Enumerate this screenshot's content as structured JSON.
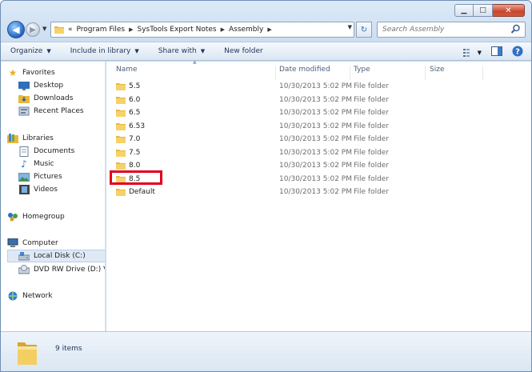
{
  "window": {
    "caption_buttons": {
      "minimize": "▁",
      "maximize": "□",
      "close": "✕"
    }
  },
  "address_bar": {
    "overflow": "«",
    "crumbs": [
      "Program Files",
      "SysTools Export Notes",
      "Assembly"
    ],
    "search_placeholder": "Search Assembly"
  },
  "toolbar": {
    "organize": "Organize",
    "include_in_library": "Include in library",
    "share_with": "Share with",
    "new_folder": "New folder"
  },
  "nav_pane": {
    "favorites": "Favorites",
    "desktop": "Desktop",
    "downloads": "Downloads",
    "recent_places": "Recent Places",
    "libraries": "Libraries",
    "documents": "Documents",
    "music": "Music",
    "pictures": "Pictures",
    "videos": "Videos",
    "homegroup": "Homegroup",
    "computer": "Computer",
    "local_disk": "Local Disk (C:)",
    "dvd_drive": "DVD RW Drive (D:) V",
    "network": "Network"
  },
  "columns": {
    "name": "Name",
    "date_modified": "Date modified",
    "type": "Type",
    "size": "Size"
  },
  "files": [
    {
      "name": "5.5",
      "date": "10/30/2013 5:02 PM",
      "type": "File folder"
    },
    {
      "name": "6.0",
      "date": "10/30/2013 5:02 PM",
      "type": "File folder"
    },
    {
      "name": "6.5",
      "date": "10/30/2013 5:02 PM",
      "type": "File folder"
    },
    {
      "name": "6.53",
      "date": "10/30/2013 5:02 PM",
      "type": "File folder"
    },
    {
      "name": "7.0",
      "date": "10/30/2013 5:02 PM",
      "type": "File folder"
    },
    {
      "name": "7.5",
      "date": "10/30/2013 5:02 PM",
      "type": "File folder"
    },
    {
      "name": "8.0",
      "date": "10/30/2013 5:02 PM",
      "type": "File folder"
    },
    {
      "name": "8.5",
      "date": "10/30/2013 5:02 PM",
      "type": "File folder"
    },
    {
      "name": "Default",
      "date": "10/30/2013 5:02 PM",
      "type": "File folder"
    }
  ],
  "status_bar": {
    "item_count": "9 items"
  },
  "colors": {
    "highlight": "#e0001b",
    "folder": "#f2c94c",
    "window_frame": "#c9dcf0"
  }
}
